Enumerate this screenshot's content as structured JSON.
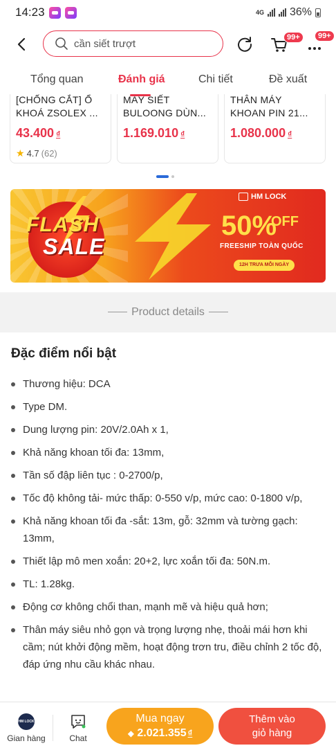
{
  "status_bar": {
    "time": "14:23",
    "network": "4G",
    "battery": "36%"
  },
  "header": {
    "search_value": "cần siết trượt",
    "cart_badge": "99+",
    "more_badge": "99+"
  },
  "tabs": [
    {
      "label": "Tổng quan"
    },
    {
      "label": "Đánh giá"
    },
    {
      "label": "Chi tiết"
    },
    {
      "label": "Đề xuất"
    }
  ],
  "related_products": [
    {
      "name_line1": "[CHỐNG CẮT] Ổ",
      "name_line2": "KHOÁ ZSOLEX ...",
      "price": "43.400",
      "currency": "₫",
      "rating": "4.7",
      "rating_count": "(62)"
    },
    {
      "name_line1": "MÁY SIẾT",
      "name_line2": "BULOONG  DÙN...",
      "price": "1.169.010",
      "currency": "₫"
    },
    {
      "name_line1": "THÂN MÁY",
      "name_line2": "KHOAN PIN 21...",
      "price": "1.080.000",
      "currency": "₫"
    }
  ],
  "banner": {
    "flash": "FLASH",
    "sale": "SALE",
    "brand": "HM LOCK",
    "percent": "50%",
    "off": "OFF",
    "freeship": "FREESHIP TOÀN QUỐC",
    "pill": "12H TRƯA MỖI NGÀY"
  },
  "product_details": {
    "title": "Product details",
    "section_heading": "Đặc điểm nổi bật",
    "features": [
      "Thương hiệu: DCA",
      "Type DM.",
      "Dung lượng pin: 20V/2.0Ah x 1,",
      "Khả năng khoan tối đa: 13mm,",
      "Tần số đập liên tục : 0-2700/p,",
      "Tốc độ không tải- mức thấp: 0-550 v/p, mức cao: 0-1800 v/p,",
      "Khả năng khoan tối đa -sắt: 13m, gỗ: 32mm và tường gạch: 13mm,",
      "Thiết lập mô men xoắn: 20+2, lực xoắn tối đa: 50N.m.",
      "TL: 1.28kg.",
      "Động cơ không chổi than, mạnh mẽ và hiệu quả hơn;",
      "Thân máy siêu nhỏ gọn và trọng lượng nhẹ, thoải mái hơn khi cầm; nút khởi động mềm, hoạt động trơn tru, điều chỉnh 2 tốc độ, đáp ứng nhu cầu khác nhau."
    ]
  },
  "bottom_bar": {
    "shop_label": "Gian hàng",
    "shop_avatar_text": "HM LOCK",
    "chat_label": "Chat",
    "buy_now_label": "Mua ngay",
    "buy_now_price": "2.021.355",
    "currency": "₫",
    "add_to_cart_line1": "Thêm vào",
    "add_to_cart_line2": "giỏ hàng"
  },
  "colors": {
    "accent": "#e8334a",
    "buy_button": "#f8a41d",
    "cart_button": "#f0503f"
  },
  "icons": [
    "back-arrow-icon",
    "search-icon",
    "refresh-icon",
    "cart-icon",
    "more-icon",
    "star-icon",
    "shop-avatar-icon",
    "chat-icon",
    "flash-icon"
  ]
}
